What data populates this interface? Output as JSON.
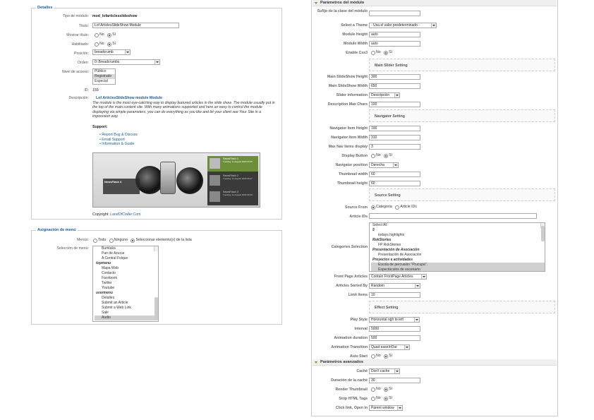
{
  "details": {
    "legend": "Detalles",
    "tipo_label": "Tipo de módulo:",
    "tipo_value": "mod_lofarticlesslideshow",
    "titulo_label": "Título:",
    "titulo_value": "Lof ArticlesSlideShow Module",
    "mostrar_label": "Mostrar título:",
    "habilitado_label": "Habilitado:",
    "no": "No",
    "si": "Sí",
    "posicion_label": "Posición:",
    "posicion_value": "breadcrumb",
    "orden_label": "Orden:",
    "orden_value": "0::Breadcrumbs",
    "acceso_label": "Nivel de acceso:",
    "acceso_options": [
      "Público",
      "Registrado",
      "Especial"
    ],
    "id_label": "ID:",
    "id_value": "159",
    "desc_label": "Descripción:",
    "desc_title": "Lof ArticlesSlideShow module Module",
    "desc_text": "The module is the most eye-catching way to display featured articles in the slide show. The module usually put in the top of the main content site. With many animations supported and here an easy to control the module displaying via simple parameters, you can do everything as you like and let your client see Your Site in a impression way.",
    "support_label": "Support:",
    "support_links": [
      "Report Bug & Discuss",
      "Email Support",
      "Information & Guide"
    ],
    "copyright_label": "Copyright:",
    "copyright_link": "LandOfCoder.Com",
    "preview_items": [
      {
        "title": "NewsFlash 1",
        "date": "Tuesday, 11 August 2009 06:25"
      },
      {
        "title": "NewsFlash 2",
        "date": "Tuesday, 11 August 2009 06:27"
      },
      {
        "title": "NewsFlash 3",
        "date": "Tuesday, 11 August 2009 06:30"
      }
    ],
    "preview_caption": "NewsFlash 4"
  },
  "menu": {
    "legend": "Asignación de menú",
    "menus_label": "Menús:",
    "opt_todo": "Todo",
    "opt_ninguno": "Ninguno",
    "opt_sel": "Seleccionar elemento(s) de la lista",
    "seleccion_label": "Selección de menú:",
    "items": [
      {
        "text": "Bumtaka",
        "bold": false
      },
      {
        "text": "Pan de Azucar",
        "bold": false
      },
      {
        "text": "A Central Folque",
        "bold": false
      },
      {
        "text": "topmenu",
        "bold": true
      },
      {
        "text": "Mapa Web",
        "bold": false
      },
      {
        "text": "Contacto",
        "bold": false
      },
      {
        "text": "Facebook",
        "bold": false
      },
      {
        "text": "Twitter",
        "bold": false
      },
      {
        "text": "Youtube",
        "bold": false
      },
      {
        "text": "usermenu",
        "bold": true
      },
      {
        "text": "Detalles",
        "bold": false
      },
      {
        "text": "Submit an Article",
        "bold": false
      },
      {
        "text": "Submit a Web Link",
        "bold": false
      },
      {
        "text": "Salir",
        "bold": false
      },
      {
        "text": "Audio",
        "bold": false
      }
    ]
  },
  "params": {
    "header": "Parámetros del módulo",
    "sufijo_label": "Sufijo de la clase del módulo",
    "sufijo_value": "",
    "theme_label": "Select a Theme",
    "theme_value": "- Usa el valor predeterminado -",
    "height_label": "Module Height",
    "height_value": "auto",
    "width_label": "Module Width",
    "width_value": "auto",
    "css3_label": "Enable Css3",
    "main_slider": "Main Slider Setting",
    "ms_height_label": "Main SlideShow Height",
    "ms_height_value": "300",
    "ms_width_label": "Main SlideShow Width",
    "ms_width_value": "650",
    "slider_info_label": "Slider information",
    "slider_info_value": "Descripción",
    "desc_max_label": "Description Max Chars",
    "desc_max_value": "100",
    "navigator": "Navigator Setting",
    "nav_h_label": "Navigator Item Height",
    "nav_h_value": "100",
    "nav_w_label": "Navigator Item Width",
    "nav_w_value": "310",
    "max_nav_label": "Max Nav Items display",
    "max_nav_value": "3",
    "display_btn_label": "Display Button",
    "nav_pos_label": "Navigator position",
    "nav_pos_value": "Derecha",
    "thumb_w_label": "Thumbnail width",
    "thumb_w_value": "60",
    "thumb_h_label": "Thumbnail height",
    "thumb_h_value": "60",
    "source": "Source Setting",
    "source_from_label": "Source From",
    "source_opt1": "Categoría",
    "source_opt2": "Article IDs",
    "article_ids_label": "Article IDs",
    "article_ids_value": "",
    "cat_sel_label": "Categories Selection",
    "categories": [
      {
        "text": "Select All",
        "style": "normal"
      },
      {
        "text": "5",
        "style": "boldital"
      },
      {
        "text": "todays highlights",
        "style": "indent"
      },
      {
        "text": "RokStories",
        "style": "boldital"
      },
      {
        "text": "FP RokStories",
        "style": "indent"
      },
      {
        "text": "Presentación de Asociación",
        "style": "boldital"
      },
      {
        "text": "Presentación de Asociación",
        "style": "indent"
      },
      {
        "text": "Proyectos e actividades",
        "style": "boldital"
      },
      {
        "text": "Escola de percusión \"Prucupá\".",
        "style": "indentsel"
      },
      {
        "text": "Espectáculos de escenario",
        "style": "indentsel"
      }
    ],
    "fp_label": "Front Page Articles",
    "fp_value": "Contain FrontPage Articles",
    "sorted_label": "Articles Sorted By",
    "sorted_value": "Random",
    "limit_label": "Limit Items",
    "limit_value": "10",
    "effect": "Effect Setting",
    "play_label": "Play Style",
    "play_value": "Horizontal righ to left",
    "interval_label": "Interval",
    "interval_value": "5000",
    "anim_dur_label": "Animation duration",
    "anim_dur_value": "500",
    "anim_tr_label": "Animation Transition",
    "anim_tr_value": "Quad easeInOut",
    "auto_label": "Auto Start",
    "no": "No",
    "si": "Sí"
  },
  "advanced": {
    "header": "Parámetros avanzados",
    "cache_label": "Caché",
    "cache_value": "Don't cache",
    "cache_dur_label": "Duración de la caché",
    "cache_dur_value": "30",
    "render_thumb_label": "Render Thumbnail",
    "strip_label": "Strip HTML Tags",
    "click_label": "Click link, Open In",
    "click_value": "Parent window"
  }
}
